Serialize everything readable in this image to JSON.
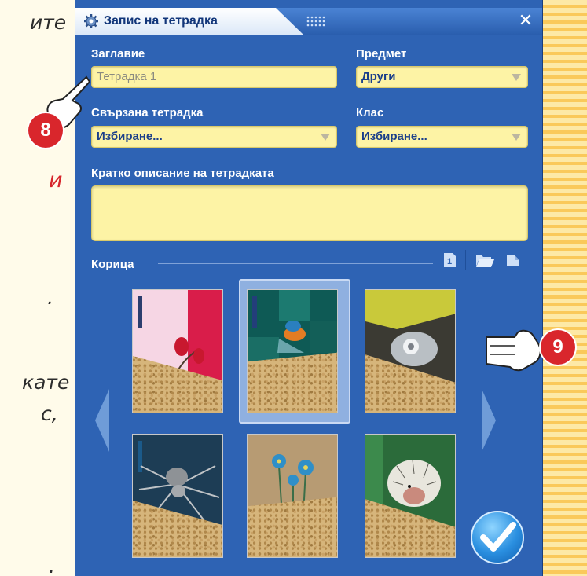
{
  "background_text": {
    "lines": [
      "ите",
      "и",
      ".",
      "кате",
      "с,",
      "."
    ]
  },
  "dialog": {
    "title": "Запис на тетрадка",
    "title_icon": "gear-icon",
    "close_icon": "close-icon",
    "grip_icon": "grip-icon"
  },
  "form": {
    "title_label": "Заглавие",
    "title_placeholder": "Тетрадка 1",
    "subject_label": "Предмет",
    "subject_value": "Други",
    "linked_label": "Свързана тетрадка",
    "linked_value": "Избиране...",
    "class_label": "Клас",
    "class_value": "Избиране...",
    "desc_label": "Кратко описание на тетрадката",
    "desc_value": ""
  },
  "cover": {
    "label": "Корица",
    "tool_page_label": "1",
    "tools": [
      "page-number-icon",
      "folder-open-icon",
      "new-page-icon"
    ],
    "thumbnails": [
      {
        "name": "thumb-flower-pink",
        "selected": false
      },
      {
        "name": "thumb-kingfisher",
        "selected": true
      },
      {
        "name": "thumb-car-headlight",
        "selected": false
      },
      {
        "name": "thumb-spider",
        "selected": false
      },
      {
        "name": "thumb-blue-flowers",
        "selected": false
      },
      {
        "name": "thumb-porcupine",
        "selected": false
      }
    ]
  },
  "callouts": [
    {
      "number": "8"
    },
    {
      "number": "9"
    }
  ],
  "colors": {
    "dialog_bg": "#2e63b4",
    "field_bg": "#fdf3a5",
    "callout_red": "#d9262c"
  }
}
